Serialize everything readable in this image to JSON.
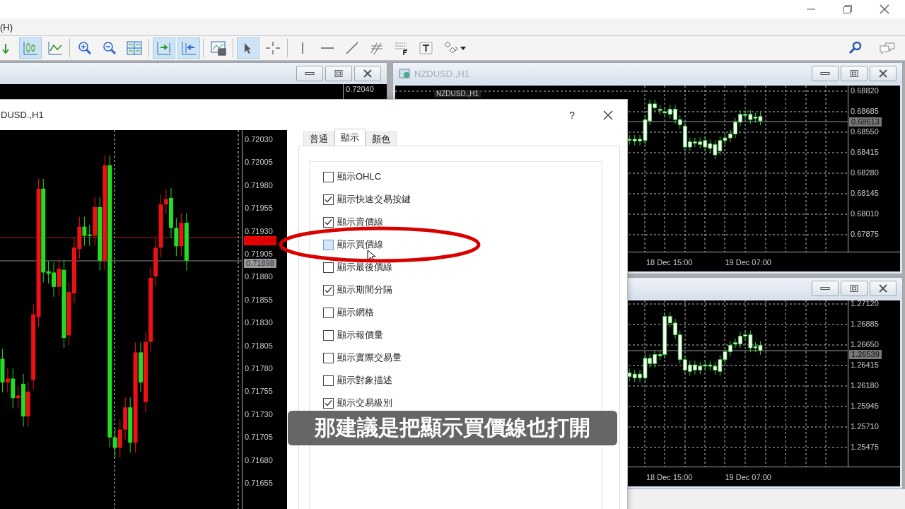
{
  "menu": {
    "item": "(H)"
  },
  "toolbar": {
    "left": [
      {
        "kind": "arrow",
        "selected": false
      },
      {
        "kind": "candles",
        "selected": true
      },
      {
        "kind": "line-chart",
        "selected": false
      },
      {
        "kind": "zoom-in",
        "selected": false
      },
      {
        "kind": "zoom-out",
        "selected": false
      },
      {
        "kind": "tile",
        "selected": false
      },
      {
        "kind": "autoscroll",
        "selected": true
      },
      {
        "kind": "shift",
        "selected": true
      },
      {
        "kind": "template",
        "selected": false
      },
      {
        "kind": "cursor",
        "selected": true
      },
      {
        "kind": "crosshair",
        "selected": false
      },
      {
        "kind": "vline",
        "selected": false
      },
      {
        "kind": "hline",
        "selected": false
      },
      {
        "kind": "trendline",
        "selected": false
      },
      {
        "kind": "channels",
        "selected": false
      },
      {
        "kind": "fibo",
        "selected": false
      },
      {
        "kind": "text",
        "selected": false
      },
      {
        "kind": "shapes",
        "selected": false
      }
    ],
    "right": [
      {
        "kind": "search",
        "selected": false
      },
      {
        "kind": "chat",
        "selected": false
      }
    ]
  },
  "left_window": {
    "price_tick": "0.72040"
  },
  "nzdusd_window": {
    "title": "NZDUSD.,H1",
    "chart_label": "NZDUSD.,H1",
    "price_ticks": [
      "0.68820",
      "0.68685",
      "0.68550",
      "0.68415",
      "0.68280",
      "0.68145",
      "0.68010",
      "0.67875"
    ],
    "current_price": "0.68613",
    "time_labels": [
      "18 Dec 15:00",
      "19 Dec 07:00"
    ]
  },
  "lower_window": {
    "price_ticks": [
      "1.27120",
      "1.26885",
      "1.26650",
      "1.26415",
      "1.26180",
      "1.25945",
      "1.25710",
      "1.25475"
    ],
    "current_price": "1.26539",
    "time_labels": [
      "18 Dec 15:00",
      "19 Dec 07:00"
    ]
  },
  "dialog": {
    "title": "DUSD.,H1",
    "help": "?",
    "chart": {
      "price_ticks": [
        "0.72030",
        "0.72005",
        "0.71980",
        "0.71955",
        "0.71930",
        "0.71905",
        "0.71880",
        "0.71855",
        "0.71830",
        "0.71805",
        "0.71780",
        "0.71755",
        "0.71730",
        "0.71705",
        "0.71680",
        "0.71655"
      ],
      "ask_price": "0.71923",
      "bid_price": "0.71898"
    },
    "tabs": [
      {
        "label": "普通",
        "selected": false
      },
      {
        "label": "顯示",
        "selected": true
      },
      {
        "label": "顏色",
        "selected": false
      }
    ],
    "options": [
      {
        "label": "顯示OHLC",
        "checked": false,
        "hovered": false
      },
      {
        "label": "顯示快速交易按鍵",
        "checked": true,
        "hovered": false
      },
      {
        "label": "顯示賣價線",
        "checked": true,
        "hovered": false
      },
      {
        "label": "顯示買價線",
        "checked": false,
        "hovered": true
      },
      {
        "label": "顯示最後價線",
        "checked": false,
        "hovered": false
      },
      {
        "label": "顯示期間分隔",
        "checked": true,
        "hovered": false
      },
      {
        "label": "顯示網格",
        "checked": false,
        "hovered": false
      },
      {
        "label": "顯示報價量",
        "checked": false,
        "hovered": false
      },
      {
        "label": "顯示實際交易量",
        "checked": false,
        "hovered": false
      },
      {
        "label": "顯示對象描述",
        "checked": false,
        "hovered": false
      },
      {
        "label": "顯示交易級別",
        "checked": true,
        "hovered": false
      }
    ]
  },
  "subtitle": "那建議是把顯示買價線也打開"
}
